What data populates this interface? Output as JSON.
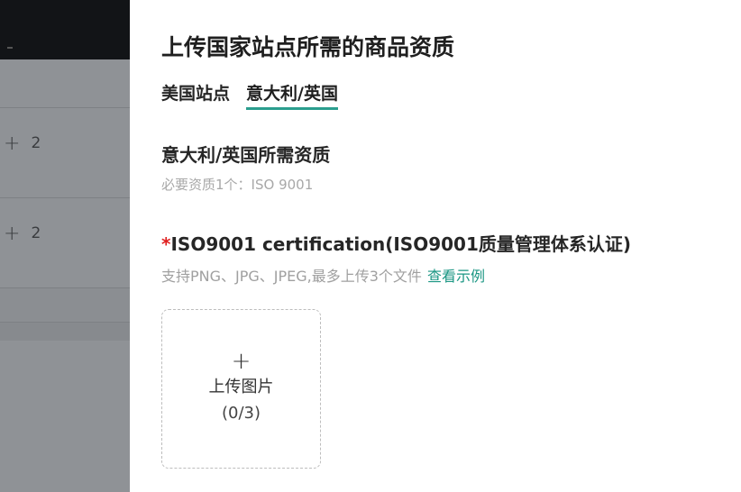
{
  "background": {
    "rows": [
      {
        "count": "2"
      },
      {
        "count": "2"
      }
    ]
  },
  "drawer": {
    "title": "上传国家站点所需的商品资质",
    "tabs": [
      {
        "label": "美国站点",
        "active": false
      },
      {
        "label": "意大利/英国",
        "active": true
      }
    ],
    "section": {
      "title": "意大利/英国所需资质",
      "subtitle": "必要资质1个：ISO 9001"
    },
    "requirement": {
      "required_mark": "*",
      "title": "ISO9001 certification(ISO9001质量管理体系认证)",
      "hint": "支持PNG、JPG、JPEG,最多上传3个文件",
      "example_link": "查看示例"
    },
    "upload": {
      "plus": "+",
      "label": "上传图片",
      "count": "(0/3)"
    }
  },
  "colors": {
    "accent": "#2b9e8e",
    "link": "#1a9683",
    "required": "#e02020",
    "overlay": "#8f9296",
    "header_dark": "#121417"
  }
}
